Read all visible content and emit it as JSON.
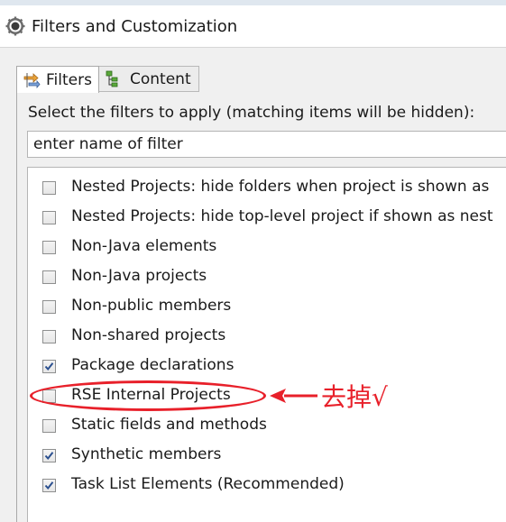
{
  "window": {
    "title": "Filters and Customization"
  },
  "tabs": [
    {
      "label": "Filters",
      "icon": "filter-arrows-icon",
      "active": true
    },
    {
      "label": "Content",
      "icon": "content-tree-icon",
      "active": false
    }
  ],
  "filters_panel": {
    "instruction": "Select the filters to apply (matching items will be hidden):",
    "filter_input_value": "enter name of filter",
    "items": [
      {
        "label": "Nested Projects: hide folders when project is shown as",
        "checked": false
      },
      {
        "label": "Nested Projects: hide top-level project if shown as nest",
        "checked": false
      },
      {
        "label": "Non-Java elements",
        "checked": false
      },
      {
        "label": "Non-Java projects",
        "checked": false
      },
      {
        "label": "Non-public members",
        "checked": false
      },
      {
        "label": "Non-shared projects",
        "checked": false
      },
      {
        "label": "Package declarations",
        "checked": true
      },
      {
        "label": "RSE Internal Projects",
        "checked": false
      },
      {
        "label": "Static fields and methods",
        "checked": false
      },
      {
        "label": "Synthetic members",
        "checked": true
      },
      {
        "label": "Task List Elements (Recommended)",
        "checked": true
      }
    ]
  },
  "annotation": {
    "text": "去掉√",
    "color": "#e8202a"
  },
  "colors": {
    "checkmark": "#2a4f8f",
    "tab_active_bg": "#ffffff",
    "dialog_bg": "#f0f0f0"
  }
}
